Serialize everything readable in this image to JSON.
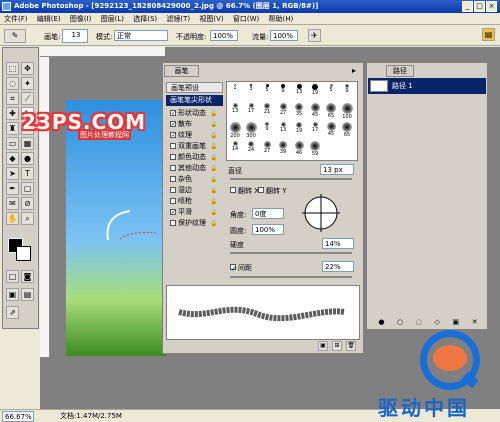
{
  "window": {
    "title": "Adobe Photoshop - [9292123_182808429000_2.jpg @ 66.7% (图层 1, RGB/8#)]",
    "controls": [
      "_",
      "□",
      "×"
    ]
  },
  "menu": [
    "文件(F)",
    "编辑(E)",
    "图像(I)",
    "图层(L)",
    "选择(S)",
    "滤镜(T)",
    "视图(V)",
    "窗口(W)",
    "帮助(H)"
  ],
  "options": {
    "brush_label": "画笔:",
    "brush_size": "13",
    "mode_label": "模式:",
    "mode_value": "正常",
    "opacity_label": "不透明度:",
    "opacity_value": "100%",
    "flow_label": "流量:",
    "flow_value": "100%"
  },
  "brushes_panel": {
    "tab": "画笔",
    "presets_label": "画笔预设",
    "tip_shape_label": "画笔笔尖形状",
    "options": [
      {
        "label": "形状动态",
        "checked": true
      },
      {
        "label": "散布",
        "checked": true
      },
      {
        "label": "纹理",
        "checked": true
      },
      {
        "label": "双重画笔",
        "checked": false
      },
      {
        "label": "颜色动态",
        "checked": false
      },
      {
        "label": "其他动态",
        "checked": false
      },
      {
        "label": "杂色",
        "checked": false
      },
      {
        "label": "湿边",
        "checked": false
      },
      {
        "label": "喷枪",
        "checked": false
      },
      {
        "label": "平滑",
        "checked": true
      },
      {
        "label": "保护纹理",
        "checked": false
      }
    ],
    "brush_sizes": [
      "1",
      "3",
      "5",
      "9",
      "13",
      "19",
      "5",
      "9",
      "13",
      "17",
      "21",
      "27",
      "35",
      "45",
      "65",
      "100",
      "200",
      "300",
      "9",
      "13",
      "19",
      "17",
      "45",
      "65",
      "14",
      "24",
      "27",
      "39",
      "46",
      "59"
    ],
    "diameter_label": "直径",
    "diameter_value": "13 px",
    "flipx_label": "翻转 X",
    "flipy_label": "翻转 Y",
    "angle_label": "角度:",
    "angle_value": "0度",
    "roundness_label": "圆度:",
    "roundness_value": "100%",
    "hardness_label": "硬度",
    "hardness_value": "14%",
    "spacing_label": "间距",
    "spacing_value": "22%"
  },
  "paths_panel": {
    "tab": "路径",
    "item": "路径 1"
  },
  "status": {
    "zoom": "66.67%",
    "doc": "文档:1.47M/2.75M"
  },
  "watermark": {
    "main": "23PS.COM",
    "sub": "图片处理教程网"
  },
  "logo": {
    "text": "驱动中国"
  }
}
